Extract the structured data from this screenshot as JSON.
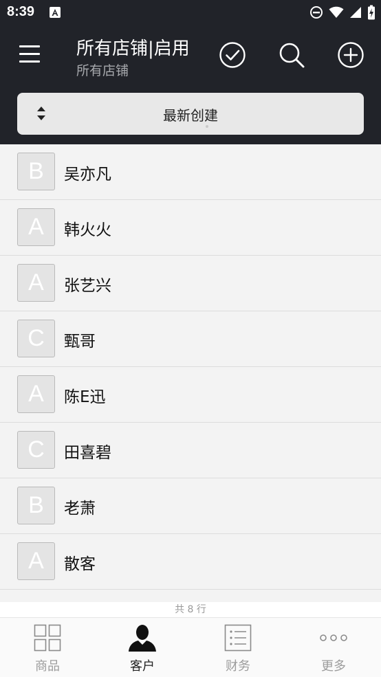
{
  "status_bar": {
    "time": "8:39",
    "icons": [
      "notification-a-icon",
      "dnd-icon",
      "wifi-icon",
      "signal-icon",
      "battery-charging-icon"
    ]
  },
  "header": {
    "title": "所有店铺|启用",
    "subtitle": "所有店铺",
    "menu_icon": "hamburger-icon",
    "actions": [
      "check-circle-icon",
      "search-icon",
      "add-circle-icon"
    ],
    "accent": "#212329"
  },
  "sort": {
    "label": "最新创建",
    "icon": "sort-updown-icon"
  },
  "customers": [
    {
      "letter": "B",
      "name": "吴亦凡"
    },
    {
      "letter": "A",
      "name": "韩火火"
    },
    {
      "letter": "A",
      "name": "张艺兴"
    },
    {
      "letter": "C",
      "name": "甄哥"
    },
    {
      "letter": "A",
      "name": "陈E迅"
    },
    {
      "letter": "C",
      "name": "田喜碧"
    },
    {
      "letter": "B",
      "name": "老萧"
    },
    {
      "letter": "A",
      "name": "散客"
    }
  ],
  "footer": {
    "count_text": "共 8 行"
  },
  "tabs": [
    {
      "label": "商品",
      "icon": "grid-icon",
      "active": false
    },
    {
      "label": "客户",
      "icon": "person-icon",
      "active": true
    },
    {
      "label": "财务",
      "icon": "list-icon",
      "active": false
    },
    {
      "label": "更多",
      "icon": "more-dots-icon",
      "active": false
    }
  ]
}
